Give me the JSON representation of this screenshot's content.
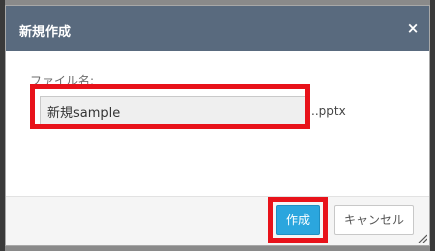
{
  "dialog": {
    "title": "新規作成",
    "close_icon": "close-icon",
    "close_glyph": "×"
  },
  "form": {
    "filename_label": "ファイル名:",
    "filename_value": "新規sample",
    "extension": "..pptx"
  },
  "footer": {
    "create_label": "作成",
    "cancel_label": "キャンセル"
  },
  "colors": {
    "titlebar": "#596a7e",
    "primary_button": "#2ba6de",
    "highlight": "#e8121a"
  }
}
